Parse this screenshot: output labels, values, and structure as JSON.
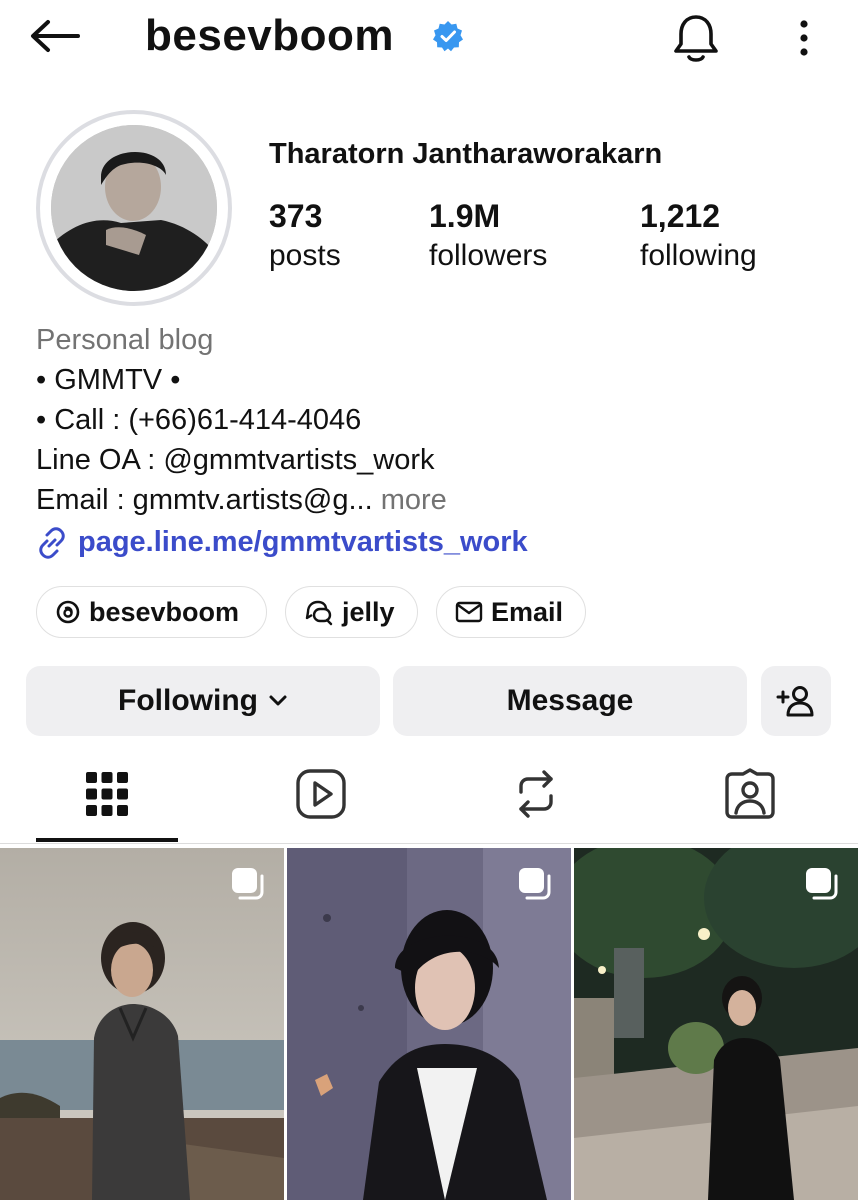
{
  "header": {
    "username": "besevboom",
    "verified": true,
    "accent_color": "#3897f0"
  },
  "profile": {
    "full_name": "Tharatorn Jantharaworakarn",
    "stats": [
      {
        "number": "373",
        "label": "posts"
      },
      {
        "number": "1.9M",
        "label": "followers"
      },
      {
        "number": "1,212",
        "label": "following"
      }
    ]
  },
  "bio": {
    "category": "Personal blog",
    "lines": [
      "• GMMTV •",
      "• Call : (+66)61-414-4046",
      "Line OA : @gmmtvartists_work",
      "Email : gmmtv.artists@g..."
    ],
    "more_label": "more",
    "link": "page.line.me/gmmtvartists_work",
    "link_color": "#3b4cca"
  },
  "pills": [
    {
      "label": "besevboom",
      "icon": "threads-icon"
    },
    {
      "label": "jelly",
      "icon": "chat-bubbles-icon"
    },
    {
      "label": "Email",
      "icon": "mail-icon"
    }
  ],
  "actions": {
    "following_label": "Following",
    "message_label": "Message",
    "add_user_icon": "add-person-icon"
  },
  "tabs": [
    {
      "name": "grid",
      "icon": "grid-icon",
      "active": true
    },
    {
      "name": "reels",
      "icon": "play-icon",
      "active": false
    },
    {
      "name": "reposts",
      "icon": "repost-icon",
      "active": false
    },
    {
      "name": "tagged",
      "icon": "tagged-person-icon",
      "active": false
    }
  ],
  "posts": [
    {
      "type": "carousel",
      "scene": "seaside portrait"
    },
    {
      "type": "carousel",
      "scene": "leather jacket portrait"
    },
    {
      "type": "carousel",
      "scene": "night street portrait"
    }
  ]
}
